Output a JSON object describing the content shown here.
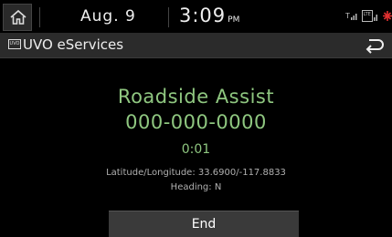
{
  "status": {
    "date": "Aug. 9",
    "time": "3:09",
    "ampm": "PM"
  },
  "header": {
    "logo_text": "UVO",
    "title": "UVO eServices"
  },
  "call": {
    "service": "Roadside Assist",
    "number": "000-000-0000",
    "timer": "0:01",
    "coordinates": "Latitude/Longitude: 33.6900/-117.8833",
    "heading": "Heading: N"
  },
  "actions": {
    "end_label": "End"
  },
  "colors": {
    "accent_green": "#8fc780",
    "alert_red": "#e03030"
  },
  "icons": [
    "home-icon",
    "signal-icon",
    "lte-icon",
    "gps-icon",
    "back-icon"
  ]
}
